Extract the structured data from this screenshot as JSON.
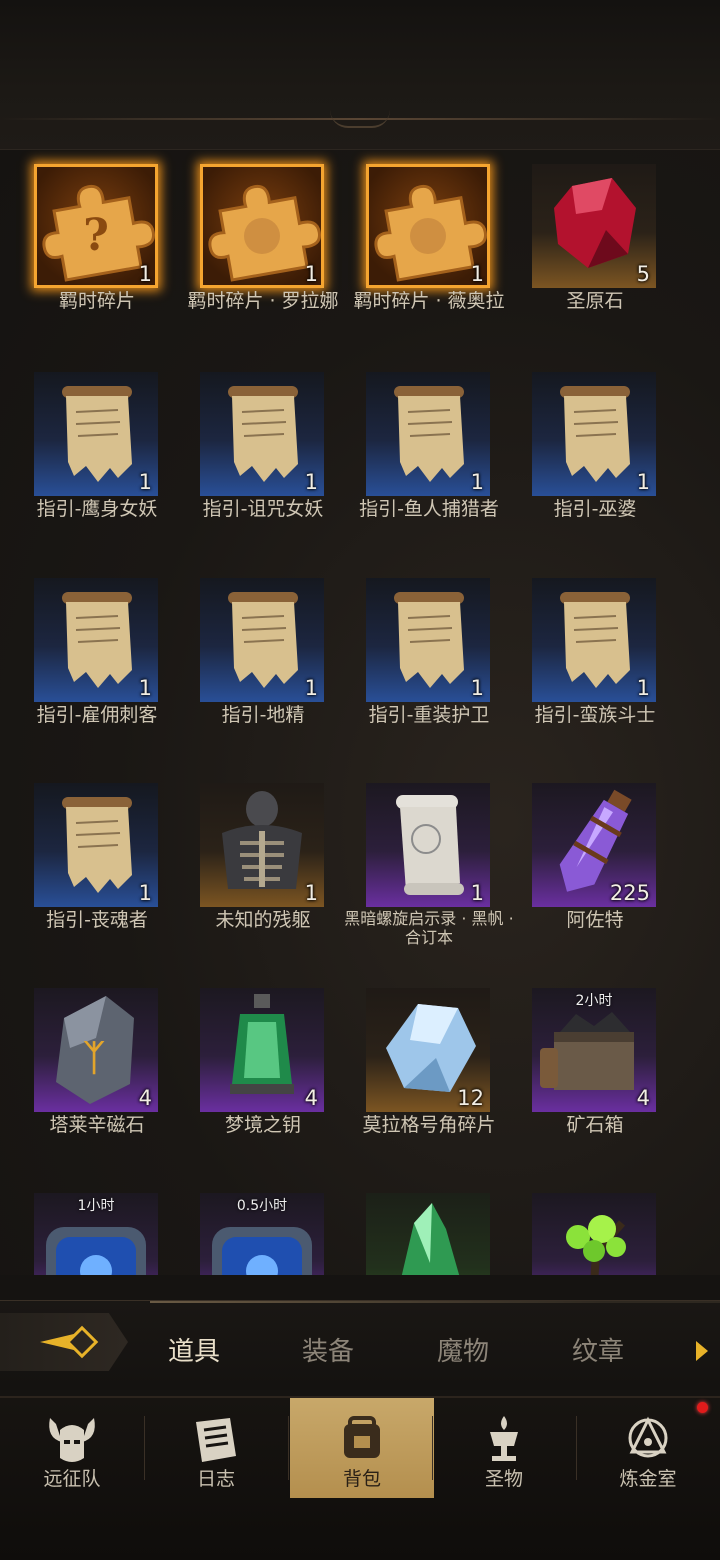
{
  "inventory": {
    "items": [
      {
        "name": "羁时碎片",
        "count": "1",
        "frame": "gold",
        "icon": "puzzle-question-icon"
      },
      {
        "name": "羁时碎片 · 罗拉娜",
        "count": "1",
        "frame": "gold",
        "icon": "puzzle-portrait-icon"
      },
      {
        "name": "羁时碎片 · 薇奥拉",
        "count": "1",
        "frame": "gold",
        "icon": "puzzle-portrait-icon"
      },
      {
        "name": "圣原石",
        "count": "5",
        "frame": "amber",
        "icon": "red-gem-icon"
      },
      {
        "name": "指引-鹰身女妖",
        "count": "1",
        "frame": "blue",
        "icon": "scroll-icon"
      },
      {
        "name": "指引-诅咒女妖",
        "count": "1",
        "frame": "blue",
        "icon": "scroll-icon"
      },
      {
        "name": "指引-鱼人捕猎者",
        "count": "1",
        "frame": "blue",
        "icon": "scroll-icon"
      },
      {
        "name": "指引-巫婆",
        "count": "1",
        "frame": "blue",
        "icon": "scroll-icon"
      },
      {
        "name": "指引-雇佣刺客",
        "count": "1",
        "frame": "blue",
        "icon": "scroll-icon"
      },
      {
        "name": "指引-地精",
        "count": "1",
        "frame": "blue",
        "icon": "scroll-icon"
      },
      {
        "name": "指引-重装护卫",
        "count": "1",
        "frame": "blue",
        "icon": "scroll-icon"
      },
      {
        "name": "指引-蛮族斗士",
        "count": "1",
        "frame": "blue",
        "icon": "scroll-icon"
      },
      {
        "name": "指引-丧魂者",
        "count": "1",
        "frame": "blue",
        "icon": "scroll-icon"
      },
      {
        "name": "未知的残躯",
        "count": "1",
        "frame": "amber",
        "icon": "skeleton-torso-icon"
      },
      {
        "name": "黑暗螺旋启示录 · 黑帆 · 合订本",
        "count": "1",
        "frame": "purple",
        "icon": "white-scroll-icon"
      },
      {
        "name": "阿佐特",
        "count": "225",
        "frame": "purple",
        "icon": "purple-crystal-vial-icon"
      },
      {
        "name": "塔莱辛磁石",
        "count": "4",
        "frame": "purple",
        "icon": "rune-stone-icon"
      },
      {
        "name": "梦境之钥",
        "count": "4",
        "frame": "purple",
        "icon": "green-lantern-icon"
      },
      {
        "name": "莫拉格号角碎片",
        "count": "12",
        "frame": "amber",
        "icon": "ice-shard-icon"
      },
      {
        "name": "矿石箱",
        "count": "4",
        "frame": "purple",
        "icon": "ore-chest-icon",
        "timer": "2小时"
      },
      {
        "name": "",
        "count": "",
        "frame": "purple",
        "icon": "blue-relic-box-icon",
        "timer": "1小时"
      },
      {
        "name": "",
        "count": "",
        "frame": "purple",
        "icon": "blue-relic-box-icon",
        "timer": "0.5小时"
      },
      {
        "name": "",
        "count": "",
        "frame": "green",
        "icon": "green-crystal-icon"
      },
      {
        "name": "",
        "count": "",
        "frame": "purple",
        "icon": "green-spore-icon"
      }
    ]
  },
  "tabs": {
    "items": [
      {
        "label": "道具",
        "active": true
      },
      {
        "label": "装备",
        "active": false
      },
      {
        "label": "魔物",
        "active": false
      },
      {
        "label": "纹章",
        "active": false
      }
    ]
  },
  "bottom_nav": {
    "items": [
      {
        "label": "远征队",
        "icon": "horned-helmet-icon",
        "active": false
      },
      {
        "label": "日志",
        "icon": "journal-icon",
        "active": false
      },
      {
        "label": "背包",
        "icon": "backpack-icon",
        "active": true
      },
      {
        "label": "圣物",
        "icon": "chalice-icon",
        "active": false
      },
      {
        "label": "炼金室",
        "icon": "alchemy-icon",
        "active": false
      }
    ]
  },
  "colors": {
    "gold_frame": "#f5a530",
    "blue_frame": "#294f97",
    "purple_frame": "#6a2fa0",
    "amber_frame": "#7c5522",
    "active_tab_text": "#e9dfc9",
    "nav_active": "#c8a86a",
    "notify": "#e01b1b"
  }
}
